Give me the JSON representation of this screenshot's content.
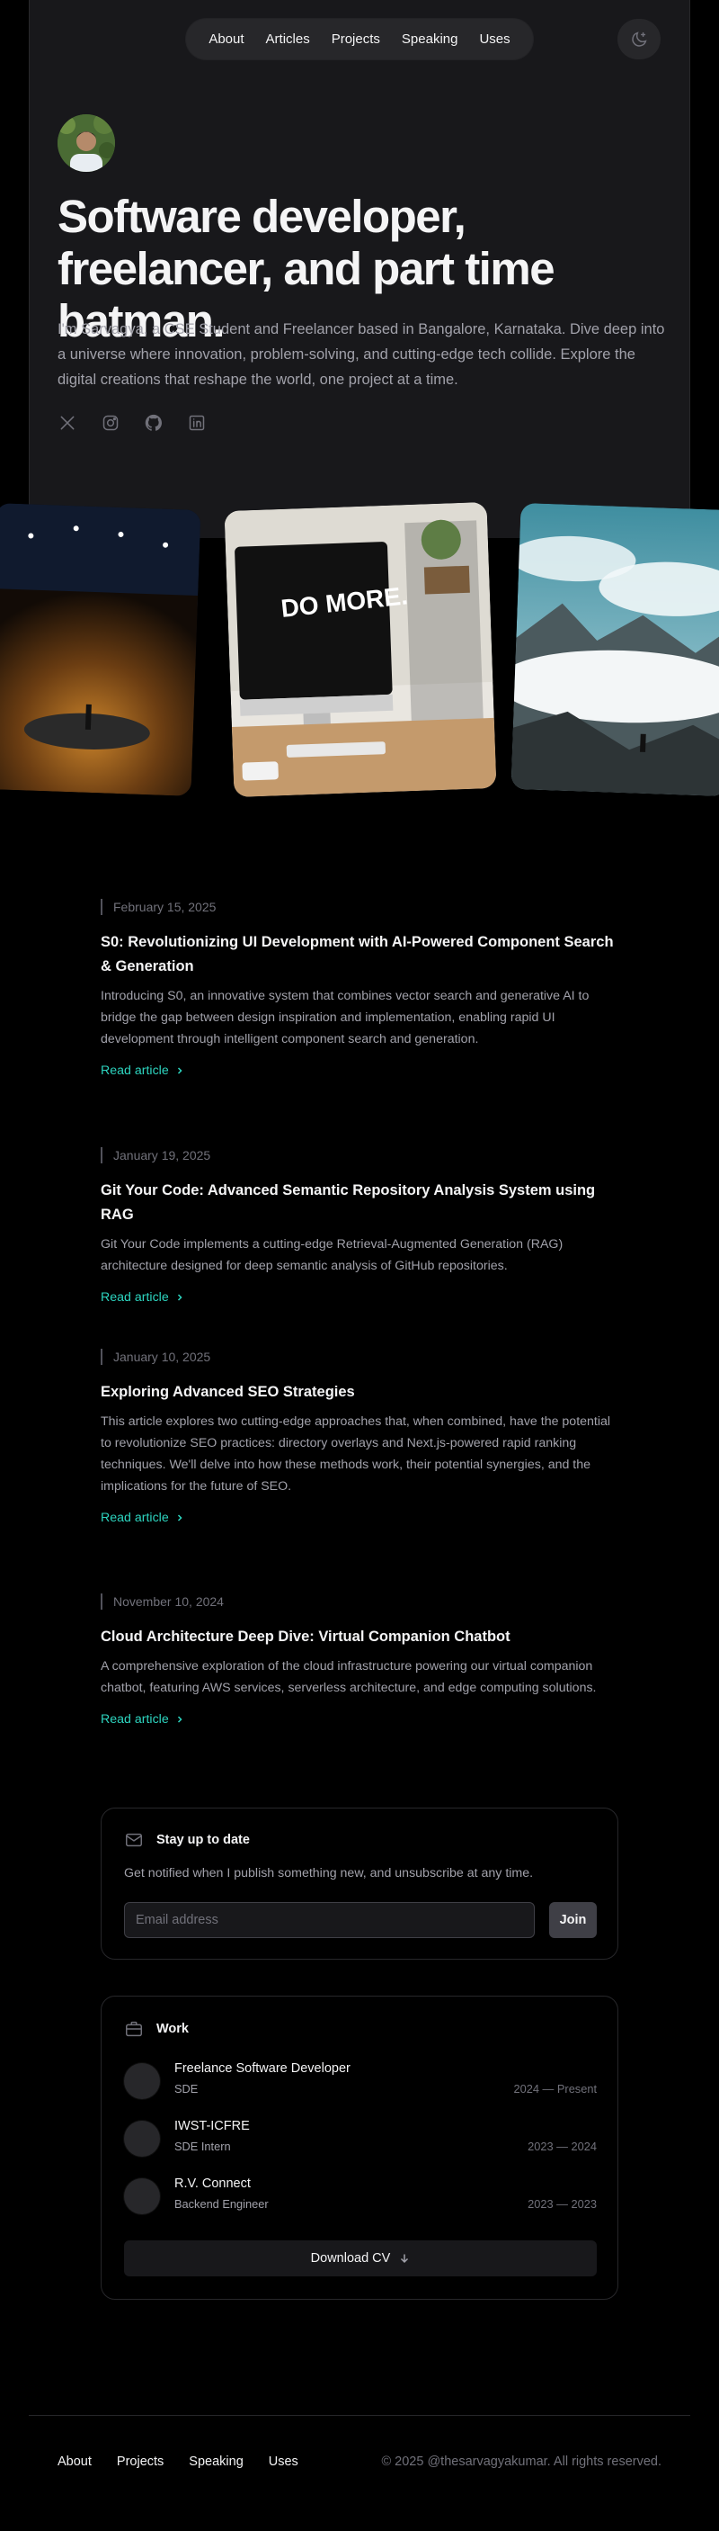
{
  "nav": {
    "items": [
      "About",
      "Articles",
      "Projects",
      "Speaking",
      "Uses"
    ]
  },
  "hero": {
    "headline": "Software developer, freelancer, and part time batman.",
    "intro": "I'm Sarvagya, a CSE Student and Freelancer based in Bangalore, Karnataka. Dive deep into a universe where innovation, problem-solving, and cutting-edge tech collide. Explore the digital creations that reshape the world, one project at a time.",
    "socials": [
      "x-icon",
      "instagram-icon",
      "github-icon",
      "linkedin-icon"
    ]
  },
  "photos": {
    "desk_sign": "DO MORE."
  },
  "articles": [
    {
      "date": "February 15, 2025",
      "title": "S0: Revolutionizing UI Development with AI-Powered Component Search & Generation",
      "description": "Introducing S0, an innovative system that combines vector search and generative AI to bridge the gap between design inspiration and implementation, enabling rapid UI development through intelligent component search and generation.",
      "cta": "Read article"
    },
    {
      "date": "January 19, 2025",
      "title": "Git Your Code: Advanced Semantic Repository Analysis System using RAG",
      "description": "Git Your Code implements a cutting-edge Retrieval-Augmented Generation (RAG) architecture designed for deep semantic analysis of GitHub repositories.",
      "cta": "Read article"
    },
    {
      "date": "January 10, 2025",
      "title": "Exploring Advanced SEO Strategies",
      "description": "This article explores two cutting-edge approaches that, when combined, have the potential to revolutionize SEO practices: directory overlays and Next.js-powered rapid ranking techniques. We'll delve into how these methods work, their potential synergies, and the implications for the future of SEO.",
      "cta": "Read article"
    },
    {
      "date": "November 10, 2024",
      "title": "Cloud Architecture Deep Dive: Virtual Companion Chatbot",
      "description": "A comprehensive exploration of the cloud infrastructure powering our virtual companion chatbot, featuring AWS services, serverless architecture, and edge computing solutions.",
      "cta": "Read article"
    }
  ],
  "newsletter": {
    "title": "Stay up to date",
    "description": "Get notified when I publish something new, and unsubscribe at any time.",
    "placeholder": "Email address",
    "button": "Join"
  },
  "work": {
    "title": "Work",
    "jobs": [
      {
        "company": "Freelance Software Developer",
        "role": "SDE",
        "dates": "2024 — Present"
      },
      {
        "company": "IWST-ICFRE",
        "role": "SDE Intern",
        "dates": "2023 — 2024"
      },
      {
        "company": "R.V. Connect",
        "role": "Backend Engineer",
        "dates": "2023 — 2023"
      }
    ],
    "cv_button": "Download CV"
  },
  "footer": {
    "links": [
      "About",
      "Projects",
      "Speaking",
      "Uses"
    ],
    "copyright": "© 2025 @thesarvagyakumar. All rights reserved."
  },
  "colors": {
    "background": "#000000",
    "card": "#18181b",
    "accent": "#2dd4bf",
    "muted": "#a1a1aa"
  }
}
